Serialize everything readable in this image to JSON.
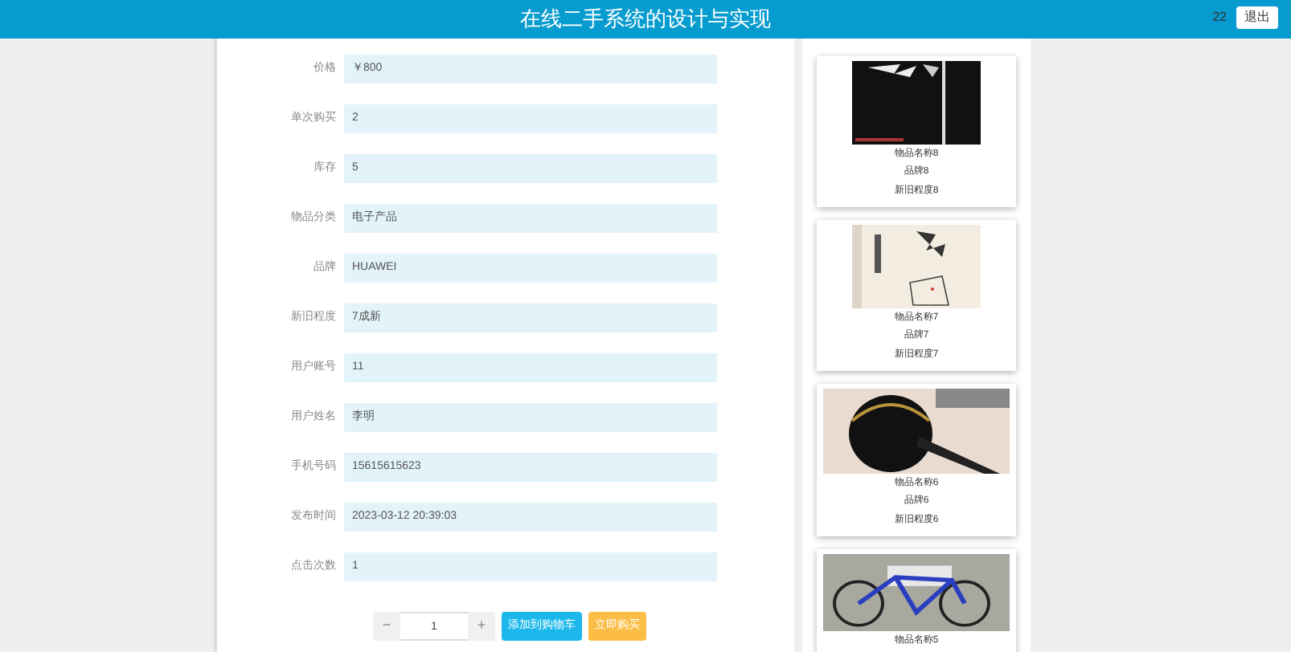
{
  "header": {
    "title": "在线二手系统的设计与实现",
    "user": "22",
    "logout": "退出"
  },
  "fields": [
    {
      "label": "价格",
      "value": "￥800"
    },
    {
      "label": "单次购买",
      "value": "2"
    },
    {
      "label": "库存",
      "value": "5"
    },
    {
      "label": "物品分类",
      "value": "电子产品"
    },
    {
      "label": "品牌",
      "value": "HUAWEI"
    },
    {
      "label": "新旧程度",
      "value": "7成新"
    },
    {
      "label": "用户账号",
      "value": "11"
    },
    {
      "label": "用户姓名",
      "value": "李明"
    },
    {
      "label": "手机号码",
      "value": "15615615623"
    },
    {
      "label": "发布时间",
      "value": "2023-03-12 20:39:03"
    },
    {
      "label": "点击次数",
      "value": "1"
    }
  ],
  "quantity": {
    "minus": "−",
    "value": "1",
    "plus": "+"
  },
  "actions": [
    "添加到购物车",
    "立即购买"
  ],
  "cards": [
    {
      "kind": "dark",
      "name": "物品名称8",
      "brand": "品牌8",
      "condition": "新旧程度8"
    },
    {
      "kind": "paper",
      "name": "物品名称7",
      "brand": "品牌7",
      "condition": "新旧程度7"
    },
    {
      "kind": "bag",
      "name": "物品名称6",
      "brand": "品牌6",
      "condition": "新旧程度6"
    },
    {
      "kind": "bike",
      "name": "物品名称5"
    }
  ]
}
